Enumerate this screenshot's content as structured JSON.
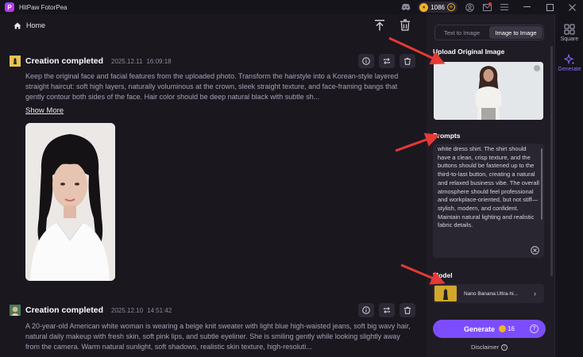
{
  "app": {
    "title": "HitPaw FotorPea",
    "logo_letter": "P"
  },
  "titlebar": {
    "credits": "1086",
    "credits_plus": "+"
  },
  "nav": {
    "home_label": "Home"
  },
  "cards": [
    {
      "title": "Creation completed",
      "date": "2025.12.11",
      "time": "16:09:18",
      "text": "Keep the original face and facial features from the uploaded photo. Transform the hairstyle into a Korean-style layered straight haircut: soft high layers, naturally voluminous at the crown, sleek straight texture, and face-framing bangs that gently contour both sides of the face. Hair color should be deep natural black with subtle sh...",
      "show_more": "Show More"
    },
    {
      "title": "Creation completed",
      "date": "2025.12.10",
      "time": "14:51:42",
      "text": "A 20-year-old American white woman is wearing a beige knit sweater with light blue high-waisted jeans, soft big wavy hair, natural daily makeup with fresh skin, soft pink lips, and subtle eyeliner. She is smiling gently while looking slightly away from the camera. Warm natural sunlight, soft shadows, realistic skin texture, high-resoluti..."
    }
  ],
  "panel": {
    "tabs": [
      "Text to Image",
      "Image to Image"
    ],
    "active_tab": 1,
    "upload_label": "Upload Original Image",
    "prompts_label": "Prompts",
    "prompt_text": "white dress shirt. The shirt should have a clean, crisp texture, and the buttons should be fastened up to the third-to-last button, creating a natural and relaxed business vibe. The overall atmosphere should feel professional and workplace-oriented, but not stiff—stylish, modern, and confident. Maintain natural lighting and realistic fabric details.",
    "model_label": "Model",
    "model_name": "Nano Banana:Ultra-hi...",
    "model_chevron": "›",
    "generate_label": "Generate",
    "generate_cost": "16",
    "generate_help": "?",
    "disclaimer": "Disclaimer",
    "info_glyph": "i"
  },
  "rail": {
    "items": [
      {
        "label": "Square",
        "icon": "square-grid-icon"
      },
      {
        "label": "Generate",
        "icon": "sparkle-icon"
      }
    ]
  },
  "colors": {
    "accent": "#7c4dff",
    "coin": "#f0b429",
    "arrow": "#e53935"
  }
}
